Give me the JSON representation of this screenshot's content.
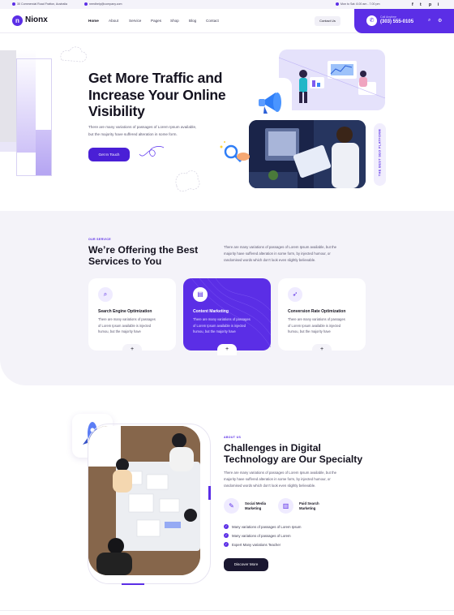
{
  "topbar": {
    "address": "30 Commercial Road Fratton, Australia",
    "email": "needhelp@company.com",
    "hours": "Mon to Sat: 8.00 am - 7.00 pm",
    "social": [
      "f",
      "t",
      "p",
      "i"
    ]
  },
  "header": {
    "logo_text": "Nionx",
    "nav": [
      "Home",
      "About",
      "Service",
      "Pages",
      "Shop",
      "Blog",
      "Contact"
    ],
    "contact_button": "Contact Us",
    "call_label": "Call Anytime",
    "call_number": "(303) 555-0105"
  },
  "hero": {
    "title_lines": [
      "Get More Traffic and",
      "Increase Your Online",
      "Visibility"
    ],
    "desc_lines": [
      "There are many variations of passages of Lorem Ipsum available,",
      "but the majority have suffered alteration in some form."
    ],
    "button": "Get In Touch",
    "vertical_badge": "THE BEST SEO PLATFORM"
  },
  "services": {
    "tag": "OUR SERVICE",
    "title_lines": [
      "We’re Offering the Best",
      "Services to You"
    ],
    "desc_lines": [
      "There are many variations of passages of Lorem Ipsum available, but the",
      "majority have suffered alteration in some form, by injected humour, or",
      "randomised words which don't look even slightly believable."
    ],
    "cards": [
      {
        "title": "Search Engine Optimization",
        "desc_lines": [
          "There are many variations of passages",
          "of Lorem Ipsum available is injected",
          "humou, but the majority have"
        ],
        "active": false
      },
      {
        "title": "Content Marketing",
        "desc_lines": [
          "There are many variations of passages",
          "of Lorem Ipsum available is injected",
          "humou, but the majority have"
        ],
        "active": true
      },
      {
        "title": "Conversion Rate Optimization",
        "desc_lines": [
          "There are many variations of passages",
          "of Lorem Ipsum available is injected",
          "humou, but the majority have"
        ],
        "active": false
      }
    ],
    "plus": "+"
  },
  "about": {
    "tag": "ABOUT US",
    "title_lines": [
      "Challenges in Digital",
      "Technology are Our Specialty"
    ],
    "desc_lines": [
      "There are many variations of passages of Lorem Ipsum available, but the",
      "majority have suffered alteration in some form, by injected humour, or",
      "randomised words which don't look even slightly believable."
    ],
    "features": [
      {
        "label_lines": [
          "Social Media",
          "Marketing"
        ]
      },
      {
        "label_lines": [
          "Paid Search",
          "Marketing"
        ]
      }
    ],
    "checklist": [
      "Many variations of passages of Lorem Ipsum",
      "Many variations of passages of Lorem",
      "Expert Many variations Teacher"
    ],
    "button": "Discover More"
  },
  "colors": {
    "accent": "#5b2ee6",
    "dark": "#14121f",
    "section_bg": "#f4f3f9"
  }
}
